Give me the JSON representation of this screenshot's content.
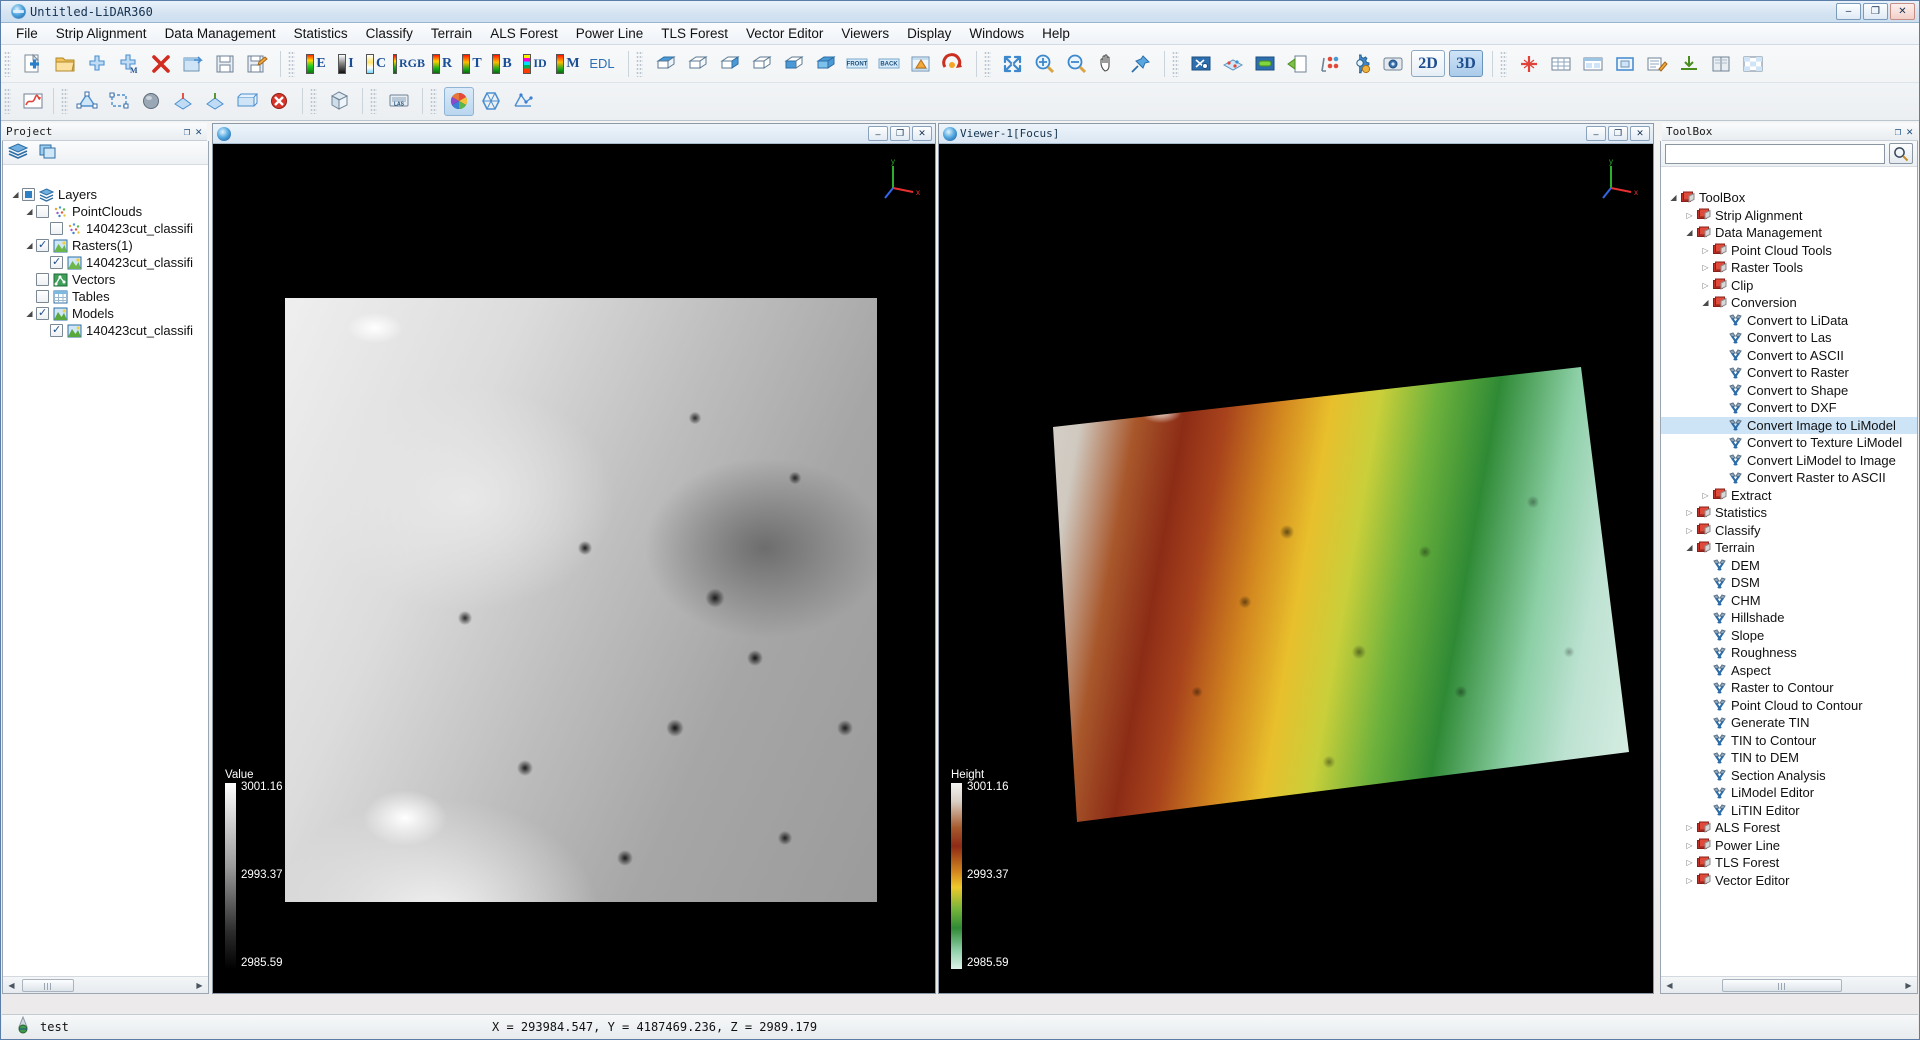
{
  "window": {
    "title": "Untitled-LiDAR360",
    "icon": "lidar360-logo-icon",
    "minimize": "–",
    "maximize": "❐",
    "close": "✕"
  },
  "menu": {
    "items": [
      "File",
      "Strip Alignment",
      "Data Management",
      "Statistics",
      "Classify",
      "Terrain",
      "ALS Forest",
      "Power Line",
      "TLS Forest",
      "Vector Editor",
      "Viewers",
      "Display",
      "Windows",
      "Help"
    ]
  },
  "toolbar": {
    "row1_file": [
      {
        "name": "new-project-icon",
        "tip": "New Project"
      },
      {
        "name": "open-project-icon",
        "tip": "Open Project"
      },
      {
        "name": "add-data-icon",
        "tip": "Add Data"
      },
      {
        "name": "add-multiple-data-icon",
        "tip": "Add Multiple Data"
      },
      {
        "name": "remove-data-icon",
        "tip": "Remove Data"
      },
      {
        "name": "export-icon",
        "tip": "Export"
      },
      {
        "name": "save-icon",
        "tip": "Save"
      },
      {
        "name": "save-as-icon",
        "tip": "Save As"
      }
    ],
    "row1_display": [
      {
        "name": "color-by-elevation-button",
        "label": "E"
      },
      {
        "name": "color-by-intensity-button",
        "label": "I"
      },
      {
        "name": "color-by-class-button",
        "label": "C"
      },
      {
        "name": "color-by-rgb-button",
        "label": "RGB"
      },
      {
        "name": "color-by-return-button",
        "label": "R"
      },
      {
        "name": "color-by-time-button",
        "label": "T"
      },
      {
        "name": "color-by-blend-button",
        "label": "B"
      },
      {
        "name": "color-by-id-button",
        "label": "ID"
      },
      {
        "name": "color-by-model-button",
        "label": "M"
      },
      {
        "name": "edl-button",
        "label": "EDL"
      }
    ],
    "row1_views": [
      {
        "name": "top-view-icon",
        "tip": "Top View"
      },
      {
        "name": "bottom-view-icon",
        "tip": "Bottom View"
      },
      {
        "name": "left-view-icon",
        "tip": "Left View"
      },
      {
        "name": "right-view-icon",
        "tip": "Right View"
      },
      {
        "name": "front-view-icon",
        "tip": "Front View"
      },
      {
        "name": "back-view-icon",
        "tip": "Back View"
      },
      {
        "name": "front-label-icon",
        "label": "FRONT"
      },
      {
        "name": "back-label-icon",
        "label": "BACK"
      },
      {
        "name": "perspective-view-icon",
        "tip": "Perspective"
      },
      {
        "name": "rotate-view-icon",
        "tip": "Rotate"
      }
    ],
    "row1_nav": [
      {
        "name": "zoom-to-extent-icon",
        "tip": "Zoom to Extent"
      },
      {
        "name": "zoom-in-icon",
        "tip": "Zoom In"
      },
      {
        "name": "zoom-out-icon",
        "tip": "Zoom Out"
      },
      {
        "name": "pan-icon",
        "tip": "Pan"
      },
      {
        "name": "pin-icon",
        "tip": "Pin"
      }
    ],
    "row1_tools": [
      {
        "name": "cut-tool-icon",
        "tip": "Cut"
      },
      {
        "name": "point-edit-icon",
        "tip": "Point Edit"
      },
      {
        "name": "link-views-icon",
        "tip": "Link Views"
      },
      {
        "name": "open-window-icon",
        "tip": "Open Window"
      },
      {
        "name": "measure-icon",
        "tip": "Measure"
      },
      {
        "name": "settings-icon",
        "tip": "Settings"
      },
      {
        "name": "snapshot-icon",
        "tip": "Snapshot"
      }
    ],
    "dim_buttons": [
      {
        "name": "view-2d-button",
        "label": "2D",
        "active": false
      },
      {
        "name": "view-3d-button",
        "label": "3D",
        "active": true
      }
    ],
    "row1_extra": [
      {
        "name": "profile-icon",
        "tip": "Profile"
      },
      {
        "name": "table-view-icon",
        "tip": "Table"
      },
      {
        "name": "layout-icon",
        "tip": "Layout"
      },
      {
        "name": "frame-icon",
        "tip": "Frame"
      },
      {
        "name": "annotate-icon",
        "tip": "Annotate"
      },
      {
        "name": "import-icon",
        "tip": "Import"
      },
      {
        "name": "book-icon",
        "tip": "Reference"
      },
      {
        "name": "grid-icon",
        "tip": "Grid"
      }
    ],
    "row2_left": [
      {
        "name": "chart-icon",
        "tip": "Chart"
      },
      {
        "name": "polygon-select-icon",
        "tip": "Polygon Select"
      },
      {
        "name": "rect-select-icon",
        "tip": "Rectangle Select"
      },
      {
        "name": "sphere-select-icon",
        "tip": "Sphere Select"
      },
      {
        "name": "inside-select-icon",
        "tip": "Inside"
      },
      {
        "name": "outside-select-icon",
        "tip": "Outside"
      },
      {
        "name": "clip-box-icon",
        "tip": "Clip Box"
      },
      {
        "name": "cancel-select-icon",
        "tip": "Cancel"
      }
    ],
    "row2_mid": [
      {
        "name": "bounding-box-icon",
        "tip": "Bounding Box"
      },
      {
        "name": "las-info-icon",
        "tip": "LAS Info"
      }
    ],
    "row2_right": [
      {
        "name": "color-wheel-icon",
        "tip": "Color Map",
        "active": true
      },
      {
        "name": "hexagon-icon",
        "tip": "Hexagon"
      },
      {
        "name": "mesh-icon",
        "tip": "Mesh"
      }
    ]
  },
  "project": {
    "title": "Project",
    "float_btn": "❐",
    "close_btn": "✕",
    "tools": [
      {
        "name": "layers-stack-icon"
      },
      {
        "name": "copy-layers-icon"
      }
    ],
    "tree": [
      {
        "label": "Layers",
        "indent": 0,
        "arrow": "open",
        "check": "half",
        "icon": "layers-icon"
      },
      {
        "label": "PointClouds",
        "indent": 1,
        "arrow": "open",
        "check": "off",
        "icon": "pointcloud-icon"
      },
      {
        "label": "140423cut_classifi",
        "indent": 2,
        "arrow": "none",
        "check": "off",
        "icon": "pointcloud-icon"
      },
      {
        "label": "Rasters(1)",
        "indent": 1,
        "arrow": "open",
        "check": "on",
        "icon": "raster-icon"
      },
      {
        "label": "140423cut_classifi",
        "indent": 2,
        "arrow": "none",
        "check": "on",
        "icon": "raster-icon"
      },
      {
        "label": "Vectors",
        "indent": 1,
        "arrow": "none",
        "check": "off",
        "icon": "vector-icon"
      },
      {
        "label": "Tables",
        "indent": 1,
        "arrow": "none",
        "check": "off",
        "icon": "table-icon"
      },
      {
        "label": "Models",
        "indent": 1,
        "arrow": "open",
        "check": "on",
        "icon": "model-icon"
      },
      {
        "label": "140423cut_classifi",
        "indent": 2,
        "arrow": "none",
        "check": "on",
        "icon": "model-icon"
      }
    ]
  },
  "toolbox": {
    "title": "ToolBox",
    "float_btn": "❐",
    "close_btn": "✕",
    "search_value": "",
    "search_placeholder": "",
    "search_icon": "search-icon",
    "tree": [
      {
        "label": "ToolBox",
        "indent": 0,
        "arrow": "open",
        "icon": "toolbox-folder-icon"
      },
      {
        "label": "Strip Alignment",
        "indent": 1,
        "arrow": "closed",
        "icon": "toolbox-folder-icon"
      },
      {
        "label": "Data Management",
        "indent": 1,
        "arrow": "open",
        "icon": "toolbox-folder-icon"
      },
      {
        "label": "Point Cloud Tools",
        "indent": 2,
        "arrow": "closed",
        "icon": "toolbox-folder-icon"
      },
      {
        "label": "Raster Tools",
        "indent": 2,
        "arrow": "closed",
        "icon": "toolbox-folder-icon"
      },
      {
        "label": "Clip",
        "indent": 2,
        "arrow": "closed",
        "icon": "toolbox-folder-icon"
      },
      {
        "label": "Conversion",
        "indent": 2,
        "arrow": "open",
        "icon": "toolbox-folder-icon"
      },
      {
        "label": "Convert to LiData",
        "indent": 3,
        "arrow": "none",
        "icon": "tool-icon"
      },
      {
        "label": "Convert to Las",
        "indent": 3,
        "arrow": "none",
        "icon": "tool-icon"
      },
      {
        "label": "Convert to ASCII",
        "indent": 3,
        "arrow": "none",
        "icon": "tool-icon"
      },
      {
        "label": "Convert to Raster",
        "indent": 3,
        "arrow": "none",
        "icon": "tool-icon"
      },
      {
        "label": "Convert to Shape",
        "indent": 3,
        "arrow": "none",
        "icon": "tool-icon"
      },
      {
        "label": "Convert to DXF",
        "indent": 3,
        "arrow": "none",
        "icon": "tool-icon"
      },
      {
        "label": "Convert Image to LiModel",
        "indent": 3,
        "arrow": "none",
        "icon": "tool-icon",
        "selected": true
      },
      {
        "label": "Convert to Texture LiModel",
        "indent": 3,
        "arrow": "none",
        "icon": "tool-icon"
      },
      {
        "label": "Convert LiModel to Image",
        "indent": 3,
        "arrow": "none",
        "icon": "tool-icon"
      },
      {
        "label": "Convert Raster to ASCII",
        "indent": 3,
        "arrow": "none",
        "icon": "tool-icon"
      },
      {
        "label": "Extract",
        "indent": 2,
        "arrow": "closed",
        "icon": "toolbox-folder-icon"
      },
      {
        "label": "Statistics",
        "indent": 1,
        "arrow": "closed",
        "icon": "toolbox-folder-icon"
      },
      {
        "label": "Classify",
        "indent": 1,
        "arrow": "closed",
        "icon": "toolbox-folder-icon"
      },
      {
        "label": "Terrain",
        "indent": 1,
        "arrow": "open",
        "icon": "toolbox-folder-icon"
      },
      {
        "label": "DEM",
        "indent": 2,
        "arrow": "none",
        "icon": "tool-icon"
      },
      {
        "label": "DSM",
        "indent": 2,
        "arrow": "none",
        "icon": "tool-icon"
      },
      {
        "label": "CHM",
        "indent": 2,
        "arrow": "none",
        "icon": "tool-icon"
      },
      {
        "label": "Hillshade",
        "indent": 2,
        "arrow": "none",
        "icon": "tool-icon"
      },
      {
        "label": "Slope",
        "indent": 2,
        "arrow": "none",
        "icon": "tool-icon"
      },
      {
        "label": "Roughness",
        "indent": 2,
        "arrow": "none",
        "icon": "tool-icon"
      },
      {
        "label": "Aspect",
        "indent": 2,
        "arrow": "none",
        "icon": "tool-icon"
      },
      {
        "label": "Raster to Contour",
        "indent": 2,
        "arrow": "none",
        "icon": "tool-icon"
      },
      {
        "label": "Point Cloud to Contour",
        "indent": 2,
        "arrow": "none",
        "icon": "tool-icon"
      },
      {
        "label": "Generate TIN",
        "indent": 2,
        "arrow": "none",
        "icon": "tool-icon"
      },
      {
        "label": "TIN to Contour",
        "indent": 2,
        "arrow": "none",
        "icon": "tool-icon"
      },
      {
        "label": "TIN to DEM",
        "indent": 2,
        "arrow": "none",
        "icon": "tool-icon"
      },
      {
        "label": "Section Analysis",
        "indent": 2,
        "arrow": "none",
        "icon": "tool-icon"
      },
      {
        "label": "LiModel Editor",
        "indent": 2,
        "arrow": "none",
        "icon": "tool-icon"
      },
      {
        "label": "LiTIN Editor",
        "indent": 2,
        "arrow": "none",
        "icon": "tool-icon"
      },
      {
        "label": "ALS Forest",
        "indent": 1,
        "arrow": "closed",
        "icon": "toolbox-folder-icon"
      },
      {
        "label": "Power Line",
        "indent": 1,
        "arrow": "closed",
        "icon": "toolbox-folder-icon"
      },
      {
        "label": "TLS Forest",
        "indent": 1,
        "arrow": "closed",
        "icon": "toolbox-folder-icon"
      },
      {
        "label": "Vector Editor",
        "indent": 1,
        "arrow": "closed",
        "icon": "toolbox-folder-icon"
      }
    ]
  },
  "viewer_2d": {
    "title": "",
    "icon": "viewer-icon",
    "minimize": "–",
    "maximize": "❐",
    "close": "✕",
    "axis_labels": {
      "x": "x",
      "y": "y",
      "z": "z"
    },
    "legend": {
      "title": "Value",
      "max": "3001.16",
      "mid": "2993.37",
      "min": "2985.59",
      "ramp": "grayscale"
    }
  },
  "viewer_3d": {
    "title": "Viewer-1[Focus]",
    "icon": "viewer-icon",
    "minimize": "–",
    "maximize": "❐",
    "close": "✕",
    "axis_labels": {
      "x": "x",
      "y": "y",
      "z": "z"
    },
    "legend": {
      "title": "Height",
      "max": "3001.16",
      "mid": "2993.37",
      "min": "2985.59",
      "ramp": "elevation"
    }
  },
  "statusbar": {
    "icon": "globe-icon",
    "project_name": "test",
    "coords": "X = 293984.547, Y = 4187469.236, Z = 2989.179"
  },
  "colors": {
    "accent": "#1f4f8f",
    "titlebar": "#d6e4f2",
    "selection": "#cde4f7",
    "panel_bg": "#ffffff",
    "viewer_bg": "#000000"
  }
}
